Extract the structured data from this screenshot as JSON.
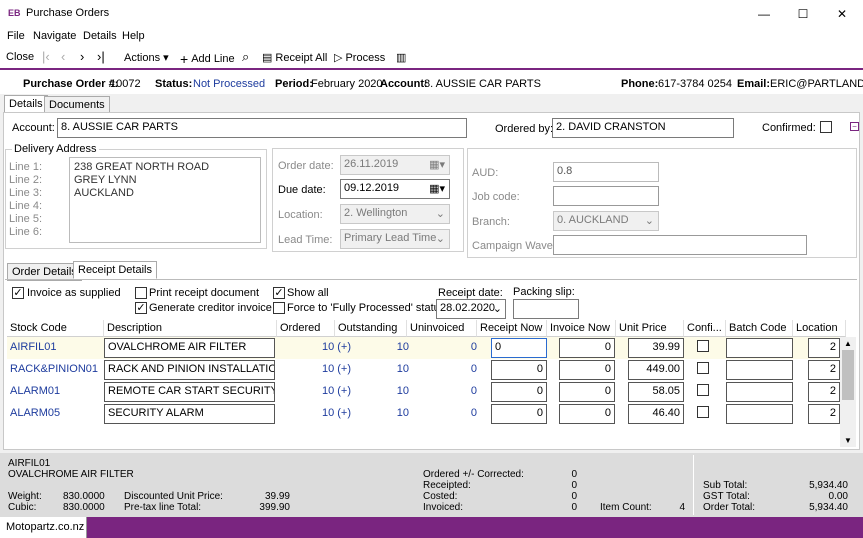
{
  "window": {
    "logo": "EB",
    "title": "Purchase Orders",
    "minimize": "—",
    "maximize": "☐",
    "close": "✕"
  },
  "menu": [
    "File",
    "Navigate",
    "Details",
    "Help"
  ],
  "toolbar": {
    "close": "Close",
    "actions": "Actions ▾",
    "add_line": "Add Line",
    "receipt_all": "Receipt All",
    "process": "Process"
  },
  "header": {
    "po_label": "Purchase Order #:",
    "po_value": "10072",
    "status_label": "Status:",
    "status_value": "Not Processed",
    "period_label": "Period:",
    "period_value": "February 2020",
    "account_label": "Account:",
    "account_value": "8. AUSSIE CAR PARTS",
    "phone_label": "Phone:",
    "phone_value": "617-3784 0254",
    "email_label": "Email:",
    "email_value": "ERIC@PARTLAND.ex"
  },
  "tabs": [
    "Details",
    "Documents"
  ],
  "details": {
    "account_label": "Account:",
    "account_value": "8. AUSSIE CAR PARTS",
    "ordered_by_label": "Ordered by:",
    "ordered_by_value": "2. DAVID CRANSTON",
    "confirmed_label": "Confirmed:"
  },
  "delivery": {
    "title": "Delivery Address",
    "line_labels": [
      "Line 1:",
      "Line 2:",
      "Line 3:",
      "Line 4:",
      "Line 5:",
      "Line 6:"
    ],
    "lines": [
      "238 GREAT NORTH ROAD",
      "GREY LYNN",
      "AUCKLAND"
    ]
  },
  "dates": {
    "order_date_label": "Order date:",
    "order_date": "26.11.2019",
    "due_date_label": "Due date:",
    "due_date": "09.12.2019",
    "location_label": "Location:",
    "location": "2. Wellington",
    "lead_time_label": "Lead Time:",
    "lead_time": "Primary Lead Time"
  },
  "currency": {
    "currency_label": "AUD:",
    "rate": "0.8",
    "job_code_label": "Job code:",
    "branch_label": "Branch:",
    "branch": "0. AUCKLAND",
    "campaign_label": "Campaign Wave:"
  },
  "subtabs": [
    "Order Details",
    "Receipt Details"
  ],
  "receipt": {
    "invoice_as_supplied": "Invoice as supplied",
    "print_receipt": "Print receipt document",
    "generate_creditor": "Generate creditor invoice",
    "show_all": "Show all",
    "force_processed": "Force to 'Fully Processed' status",
    "receipt_date_label": "Receipt date:",
    "receipt_date": "28.02.2020",
    "packing_slip_label": "Packing slip:"
  },
  "grid": {
    "columns": [
      "Stock Code",
      "Description",
      "Ordered",
      "Outstanding",
      "Uninvoiced",
      "Receipt Now",
      "Invoice Now",
      "Unit Price",
      "Confi...",
      "Batch Code",
      "Location"
    ],
    "rows": [
      {
        "code": "AIRFIL01",
        "desc": "OVALCHROME AIR FILTER",
        "ordered": "10 (+)",
        "outstanding": "10",
        "uninvoiced": "0",
        "receipt_now": "0",
        "invoice_now": "0",
        "unit_price": "39.99",
        "location": "2"
      },
      {
        "code": "RACK&PINION01",
        "desc": "RACK AND PINION INSTALLATION KI",
        "ordered": "10 (+)",
        "outstanding": "10",
        "uninvoiced": "0",
        "receipt_now": "0",
        "invoice_now": "0",
        "unit_price": "449.00",
        "location": "2"
      },
      {
        "code": "ALARM01",
        "desc": "REMOTE CAR START SECURITY",
        "ordered": "10 (+)",
        "outstanding": "10",
        "uninvoiced": "0",
        "receipt_now": "0",
        "invoice_now": "0",
        "unit_price": "58.05",
        "location": "2"
      },
      {
        "code": "ALARM05",
        "desc": "SECURITY ALARM",
        "ordered": "10 (+)",
        "outstanding": "10",
        "uninvoiced": "0",
        "receipt_now": "0",
        "invoice_now": "0",
        "unit_price": "46.40",
        "location": "2"
      }
    ]
  },
  "footer": {
    "code": "AIRFIL01",
    "desc": "OVALCHROME AIR FILTER",
    "weight_label": "Weight:",
    "weight": "830.0000",
    "cubic_label": "Cubic:",
    "cubic": "830.0000",
    "disc_label": "Discounted Unit Price:",
    "disc": "39.99",
    "pretax_label": "Pre-tax line Total:",
    "pretax": "399.90",
    "ordered_corr_label": "Ordered +/- Corrected:",
    "ordered_corr": "0",
    "receipted_label": "Receipted:",
    "receipted": "0",
    "costed_label": "Costed:",
    "costed": "0",
    "invoiced_label": "Invoiced:",
    "invoiced": "0",
    "item_count_label": "Item Count:",
    "item_count": "4",
    "subtotal_label": "Sub Total:",
    "subtotal": "5,934.40",
    "gst_label": "GST Total:",
    "gst": "0.00",
    "order_total_label": "Order Total:",
    "order_total": "5,934.40"
  },
  "statusbar": {
    "text": "Motopartz.co.nz"
  }
}
